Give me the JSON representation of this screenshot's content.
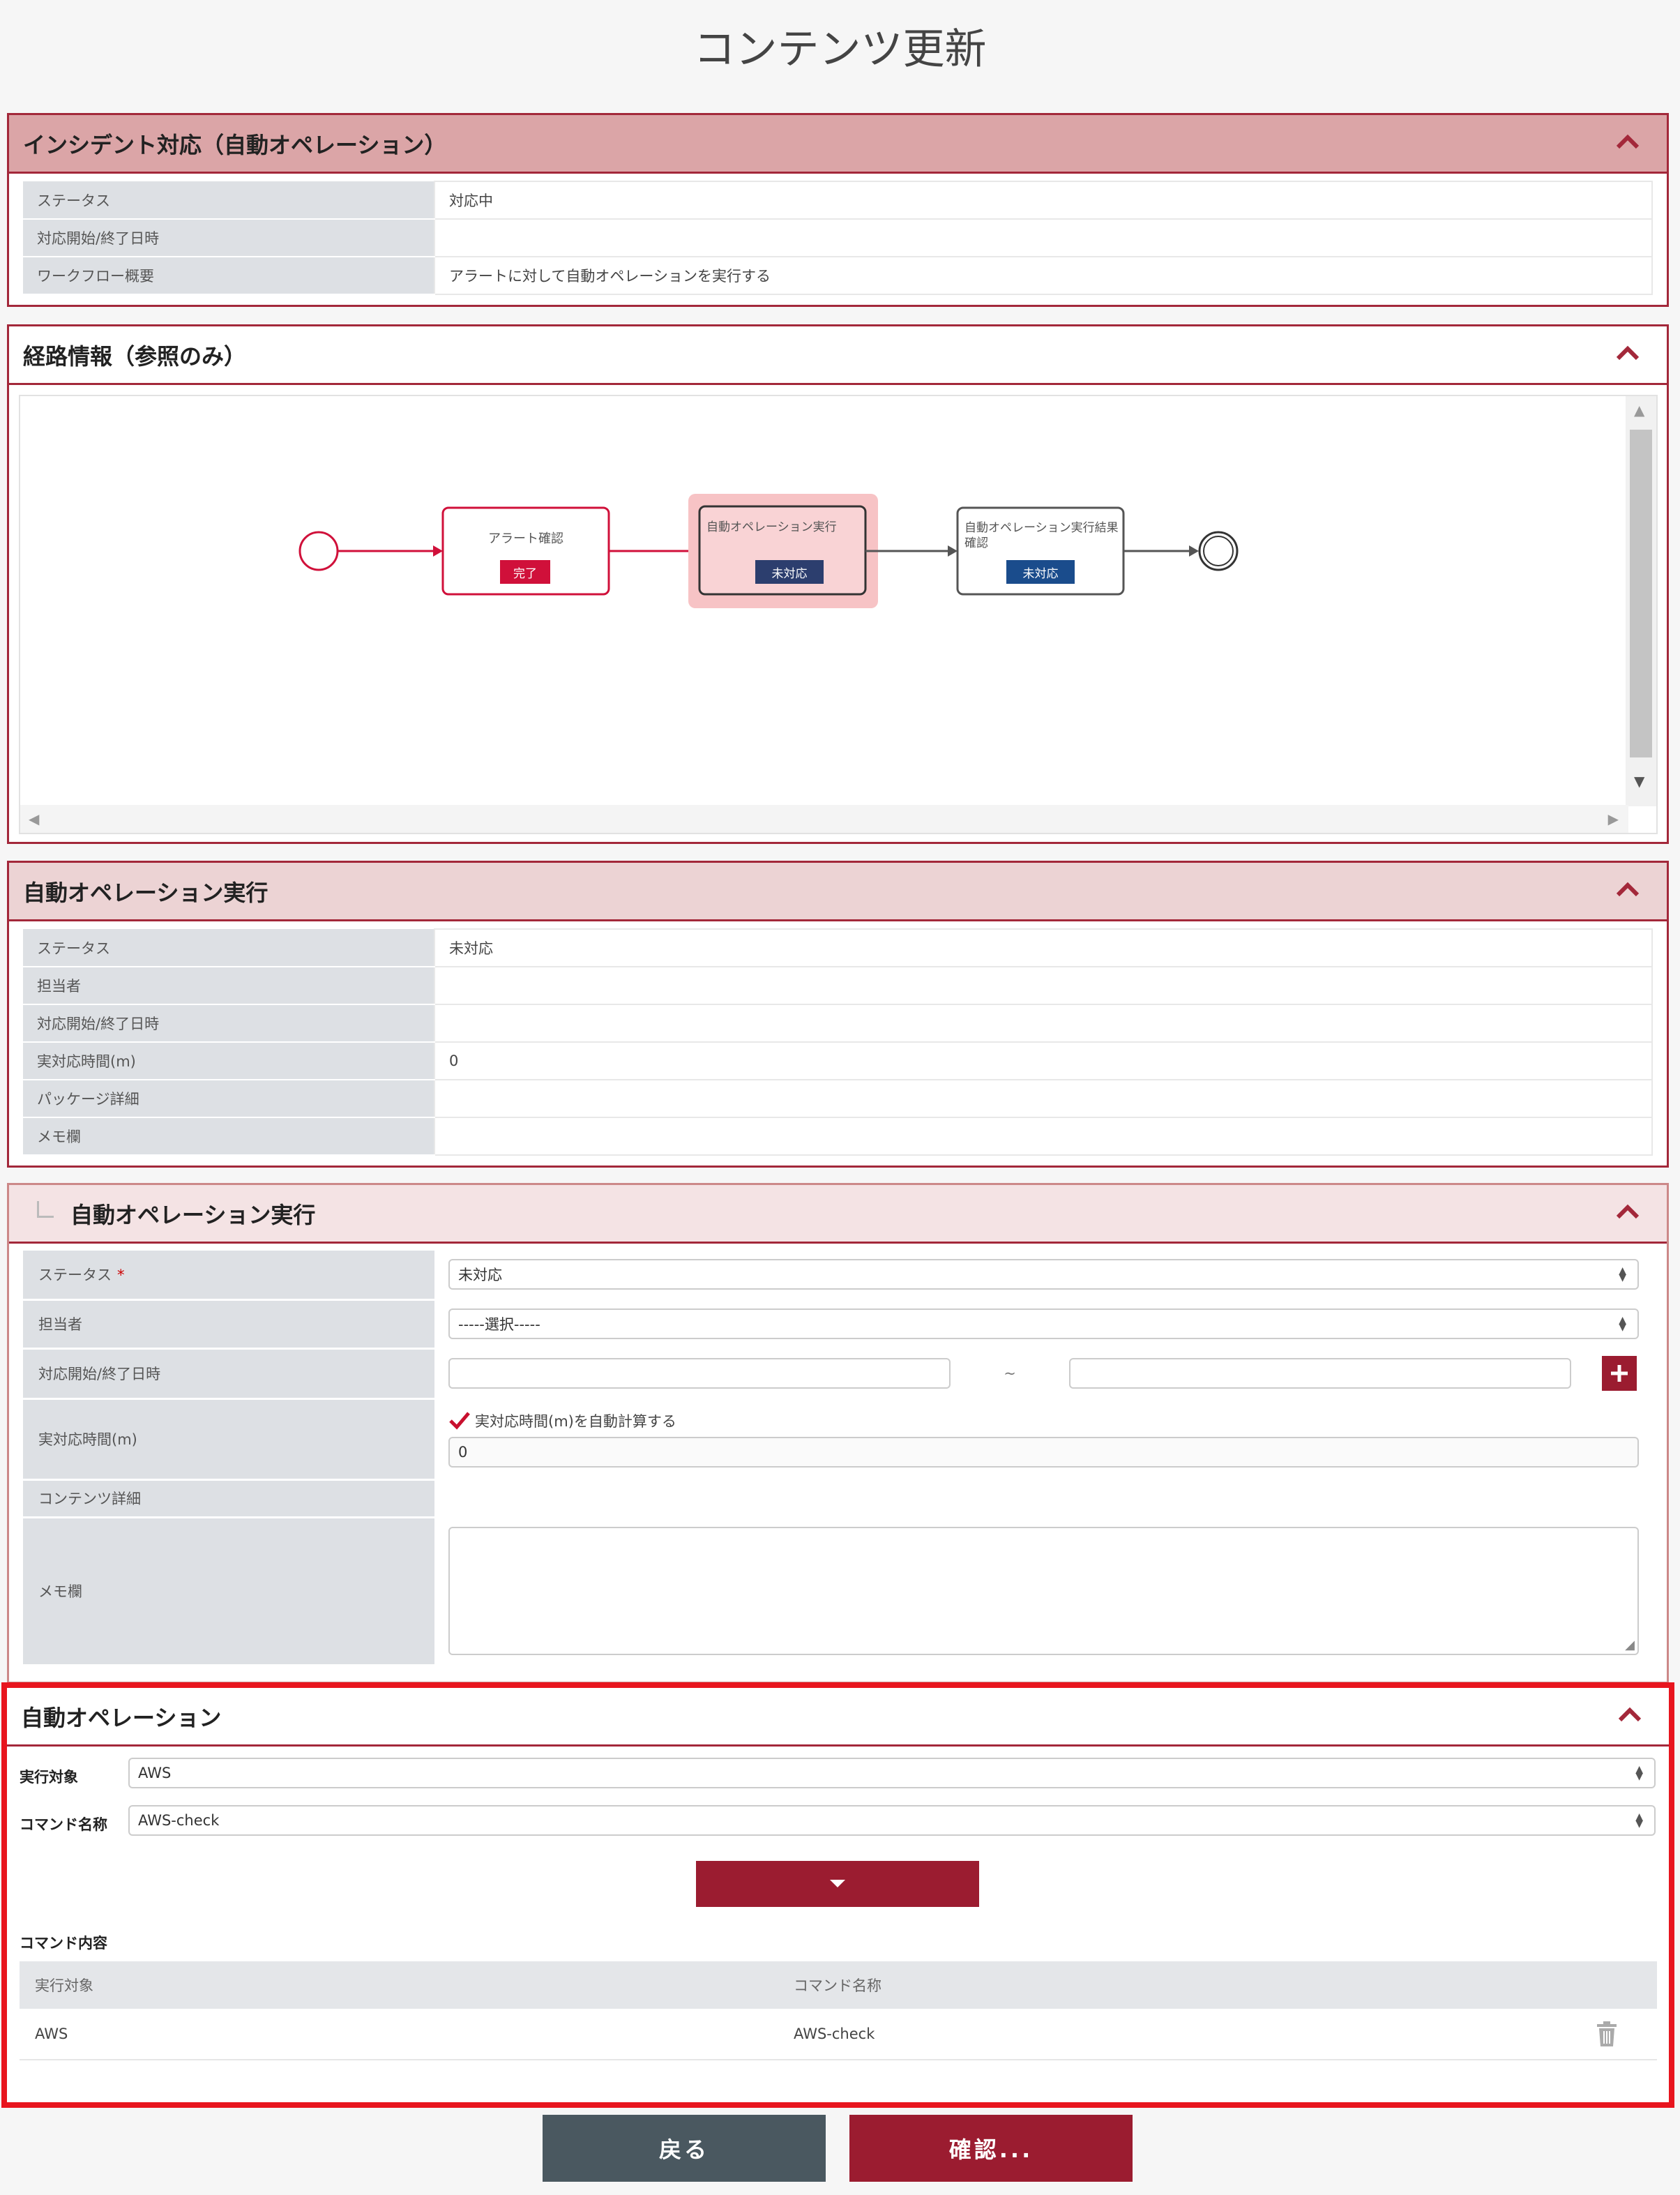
{
  "page": {
    "title": "コンテンツ更新"
  },
  "incident": {
    "title": "インシデント対応（自動オペレーション）",
    "rows": [
      {
        "k": "ステータス",
        "v": "対応中"
      },
      {
        "k": "対応開始/終了日時",
        "v": ""
      },
      {
        "k": "ワークフロー概要",
        "v": "アラートに対して自動オペレーションを実行する"
      }
    ]
  },
  "route": {
    "title": "経路情報（参照のみ）",
    "nodes": [
      {
        "label": "アラート確認",
        "status": "完了",
        "status_color": "#d0103a"
      },
      {
        "label": "自動オペレーション実行",
        "status": "未対応",
        "status_color": "#2c3e6e"
      },
      {
        "label": "自動オペレーション実行結果確認",
        "status": "未対応",
        "status_color": "#1a4c8c"
      }
    ]
  },
  "exec_info": {
    "title": "自動オペレーション実行",
    "rows": [
      {
        "k": "ステータス",
        "v": "未対応"
      },
      {
        "k": "担当者",
        "v": ""
      },
      {
        "k": "対応開始/終了日時",
        "v": ""
      },
      {
        "k": "実対応時間(m)",
        "v": "0"
      },
      {
        "k": "パッケージ詳細",
        "v": ""
      },
      {
        "k": "メモ欄",
        "v": ""
      }
    ]
  },
  "exec_form": {
    "title": "自動オペレーション実行",
    "status_label": "ステータス",
    "required_mark": "*",
    "status_value": "未対応",
    "assignee_label": "担当者",
    "assignee_value": "-----選択-----",
    "datetime_label": "対応開始/終了日時",
    "datetime_sep": "~",
    "time_label": "実対応時間(m)",
    "auto_calc_label": "実対応時間(m)を自動計算する",
    "time_value": "0",
    "content_label": "コンテンツ詳細",
    "memo_label": "メモ欄"
  },
  "auto_op": {
    "title": "自動オペレーション",
    "target_label": "実行対象",
    "target_value": "AWS",
    "command_label": "コマンド名称",
    "command_value": "AWS-check",
    "content_label": "コマンド内容",
    "table": {
      "headers": [
        "実行対象",
        "コマンド名称"
      ],
      "rows": [
        {
          "target": "AWS",
          "command": "AWS-check"
        }
      ]
    }
  },
  "buttons": {
    "back": "戻る",
    "confirm": "確認..."
  },
  "colors": {
    "accent": "#9b1c30",
    "highlight": "#e8151e",
    "back_btn": "#4a5860"
  }
}
